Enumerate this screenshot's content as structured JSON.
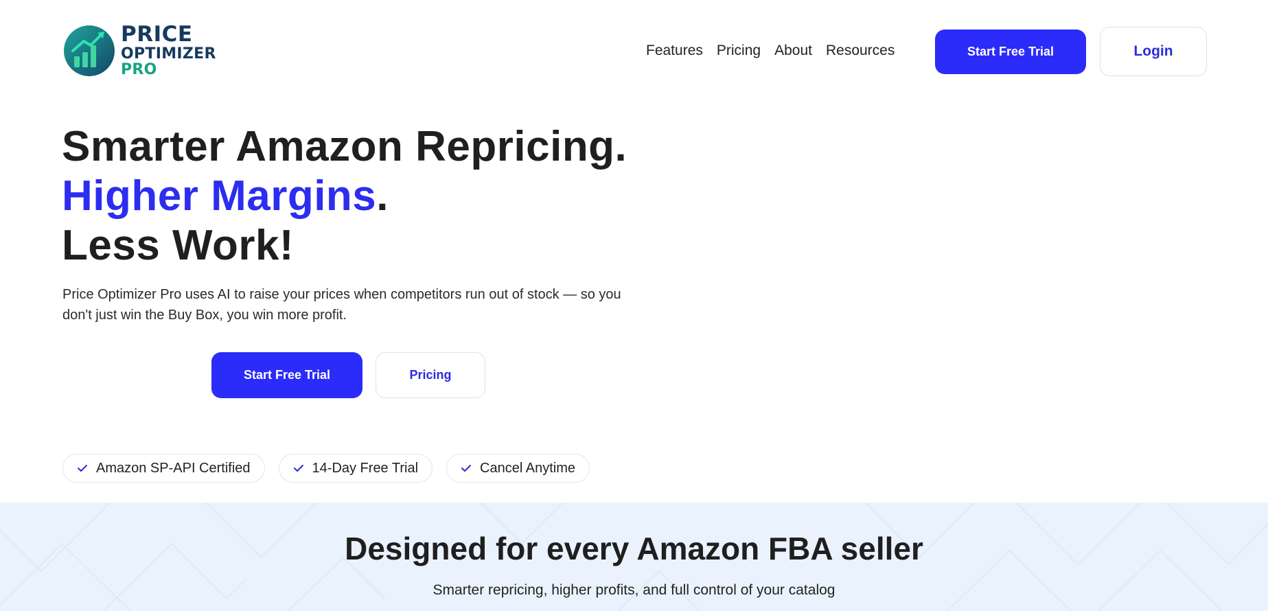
{
  "logo": {
    "line1": "PRICE",
    "line2": "OPTIMIZER",
    "line3": "PRO",
    "icon": "chart-growth-icon",
    "colors": {
      "dark": "#163a5f",
      "teal": "#17a384"
    }
  },
  "nav": {
    "items": [
      "Features",
      "Pricing",
      "About",
      "Resources"
    ]
  },
  "header": {
    "trial_label": "Start Free Trial",
    "login_label": "Login"
  },
  "hero": {
    "title_line1": "Smarter Amazon Repricing.",
    "title_line2_accent": "Higher Margins",
    "title_line2_end": ".",
    "title_line3": "Less Work!",
    "subtitle": "Price Optimizer Pro uses AI to raise your prices when competitors run out of stock — so you don't just win the Buy Box, you win more profit.",
    "cta_trial": "Start Free Trial",
    "cta_pricing": "Pricing"
  },
  "badges": [
    {
      "label": "Amazon SP-API Certified",
      "icon": "check-icon"
    },
    {
      "label": "14-Day Free Trial",
      "icon": "check-icon"
    },
    {
      "label": "Cancel Anytime",
      "icon": "check-icon"
    }
  ],
  "section": {
    "title": "Designed for every Amazon FBA seller",
    "subtitle": "Smarter repricing, higher profits, and full control of your catalog"
  },
  "colors": {
    "accent": "#2b2bfa",
    "accent_text": "#2d2df0",
    "section_bg": "#eaf3fd"
  }
}
